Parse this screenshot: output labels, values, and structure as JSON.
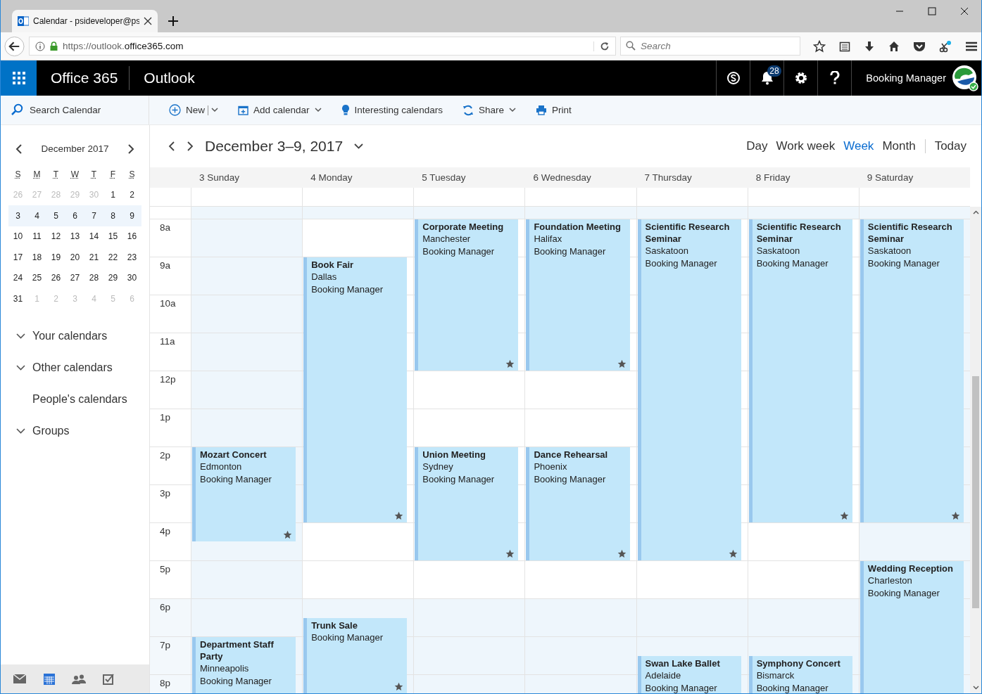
{
  "browser": {
    "tab_title": "Calendar - psideveloper@ps",
    "url_host_prefix": "https://outlook.",
    "url_host": "office365.com",
    "search": {
      "placeholder": "Search"
    }
  },
  "suite": {
    "brand": "Office 365",
    "app": "Outlook",
    "notifications": "28",
    "user": "Booking Manager"
  },
  "search": {
    "placeholder": "Search Calendar"
  },
  "commands": [
    {
      "label": "New",
      "kind": "new"
    },
    {
      "label": "Add calendar",
      "kind": "add"
    },
    {
      "label": "Interesting calendars",
      "kind": "bulb"
    },
    {
      "label": "Share",
      "kind": "share"
    },
    {
      "label": "Print",
      "kind": "print"
    }
  ],
  "mini_calendar": {
    "title": "December 2017",
    "weekdays": [
      "S",
      "M",
      "T",
      "W",
      "T",
      "F",
      "S"
    ],
    "weeks": [
      {
        "selected": false,
        "days": [
          {
            "label": "26",
            "other_month": true
          },
          {
            "label": "27",
            "other_month": true
          },
          {
            "label": "28",
            "other_month": true
          },
          {
            "label": "29",
            "other_month": true
          },
          {
            "label": "30",
            "other_month": true
          },
          {
            "label": "1",
            "other_month": false
          },
          {
            "label": "2",
            "other_month": false
          }
        ]
      },
      {
        "selected": true,
        "days": [
          {
            "label": "3",
            "other_month": false
          },
          {
            "label": "4",
            "other_month": false
          },
          {
            "label": "5",
            "other_month": false
          },
          {
            "label": "6",
            "other_month": false
          },
          {
            "label": "7",
            "other_month": false
          },
          {
            "label": "8",
            "other_month": false
          },
          {
            "label": "9",
            "other_month": false
          }
        ]
      },
      {
        "selected": false,
        "days": [
          {
            "label": "10",
            "other_month": false
          },
          {
            "label": "11",
            "other_month": false
          },
          {
            "label": "12",
            "other_month": false
          },
          {
            "label": "13",
            "other_month": false
          },
          {
            "label": "14",
            "other_month": false
          },
          {
            "label": "15",
            "other_month": false
          },
          {
            "label": "16",
            "other_month": false
          }
        ]
      },
      {
        "selected": false,
        "days": [
          {
            "label": "17",
            "other_month": false
          },
          {
            "label": "18",
            "other_month": false
          },
          {
            "label": "19",
            "other_month": false
          },
          {
            "label": "20",
            "other_month": false
          },
          {
            "label": "21",
            "other_month": false
          },
          {
            "label": "22",
            "other_month": false
          },
          {
            "label": "23",
            "other_month": false
          }
        ]
      },
      {
        "selected": false,
        "days": [
          {
            "label": "24",
            "other_month": false
          },
          {
            "label": "25",
            "other_month": false
          },
          {
            "label": "26",
            "other_month": false
          },
          {
            "label": "27",
            "other_month": false
          },
          {
            "label": "28",
            "other_month": false
          },
          {
            "label": "29",
            "other_month": false
          },
          {
            "label": "30",
            "other_month": false
          }
        ]
      },
      {
        "selected": false,
        "days": [
          {
            "label": "31",
            "other_month": false
          },
          {
            "label": "1",
            "other_month": true
          },
          {
            "label": "2",
            "other_month": true
          },
          {
            "label": "3",
            "other_month": true
          },
          {
            "label": "4",
            "other_month": true
          },
          {
            "label": "5",
            "other_month": true
          },
          {
            "label": "6",
            "other_month": true
          }
        ]
      }
    ]
  },
  "calendar_groups": [
    {
      "label": "Your calendars",
      "expanded": false,
      "kind": "group"
    },
    {
      "label": "Other calendars",
      "expanded": false,
      "kind": "group"
    },
    {
      "label": "People's calendars",
      "kind": "link"
    },
    {
      "label": "Groups",
      "expanded": false,
      "kind": "group"
    }
  ],
  "bottom_nav": [
    {
      "kind": "mail",
      "selected": false
    },
    {
      "kind": "calendar",
      "selected": true
    },
    {
      "kind": "people",
      "selected": false
    },
    {
      "kind": "tasks",
      "selected": false
    }
  ],
  "range_title": "December 3–9, 2017",
  "views": [
    {
      "label": "Day",
      "selected": false
    },
    {
      "label": "Work week",
      "selected": false
    },
    {
      "label": "Week",
      "selected": true
    },
    {
      "label": "Month",
      "selected": false
    },
    {
      "label": "Today",
      "selected": false
    }
  ],
  "days": [
    {
      "label": "3 Sunday",
      "off_day": true
    },
    {
      "label": "4 Monday",
      "off_day": false
    },
    {
      "label": "5 Tuesday",
      "off_day": false
    },
    {
      "label": "6 Wednesday",
      "off_day": false
    },
    {
      "label": "7 Thursday",
      "off_day": false
    },
    {
      "label": "8 Friday",
      "off_day": false
    },
    {
      "label": "9 Saturday",
      "off_day": true
    }
  ],
  "hours": [
    {
      "label": "8a",
      "off_hours": false
    },
    {
      "label": "9a",
      "off_hours": false
    },
    {
      "label": "10a",
      "off_hours": false
    },
    {
      "label": "11a",
      "off_hours": false
    },
    {
      "label": "12p",
      "off_hours": false
    },
    {
      "label": "1p",
      "off_hours": false
    },
    {
      "label": "2p",
      "off_hours": false
    },
    {
      "label": "3p",
      "off_hours": false
    },
    {
      "label": "4p",
      "off_hours": false
    },
    {
      "label": "5p",
      "off_hours": false
    },
    {
      "label": "6p",
      "off_hours": true
    },
    {
      "label": "7p",
      "off_hours": true
    },
    {
      "label": "8p",
      "off_hours": true
    }
  ],
  "events": [
    {
      "title": "Book Fair",
      "location": "Dallas",
      "organizer": "Booking Manager",
      "starred": true
    },
    {
      "title": "Corporate Meeting",
      "location": "Manchester",
      "organizer": "Booking Manager",
      "starred": true
    },
    {
      "title": "Foundation Meeting",
      "location": "Halifax",
      "organizer": "Booking Manager",
      "starred": true
    },
    {
      "title": "Scientific Research Seminar",
      "location": "Saskatoon",
      "organizer": "Booking Manager",
      "starred": true
    },
    {
      "title": "Scientific Research Seminar",
      "location": "Saskatoon",
      "organizer": "Booking Manager",
      "starred": true
    },
    {
      "title": "Scientific Research Seminar",
      "location": "Saskatoon",
      "organizer": "Booking Manager",
      "starred": true
    },
    {
      "title": "Mozart Concert",
      "location": "Edmonton",
      "organizer": "Booking Manager",
      "starred": true
    },
    {
      "title": "Union Meeting",
      "location": "Sydney",
      "organizer": "Booking Manager",
      "starred": true
    },
    {
      "title": "Dance Rehearsal",
      "location": "Phoenix",
      "organizer": "Booking Manager",
      "starred": true
    },
    {
      "title": "Wedding Reception",
      "location": "Charleston",
      "organizer": "Booking Manager",
      "starred": false
    },
    {
      "title": "Trunk Sale",
      "organizer": "Booking Manager",
      "starred": true
    },
    {
      "title": "Department Staff Party",
      "location": "Minneapolis",
      "organizer": "Booking Manager",
      "starred": false
    },
    {
      "title": "Swan Lake Ballet",
      "location": "Adelaide",
      "organizer": "Booking Manager",
      "starred": false
    },
    {
      "title": "Symphony Concert",
      "location": "Bismarck",
      "organizer": "Booking Manager",
      "starred": false
    }
  ]
}
